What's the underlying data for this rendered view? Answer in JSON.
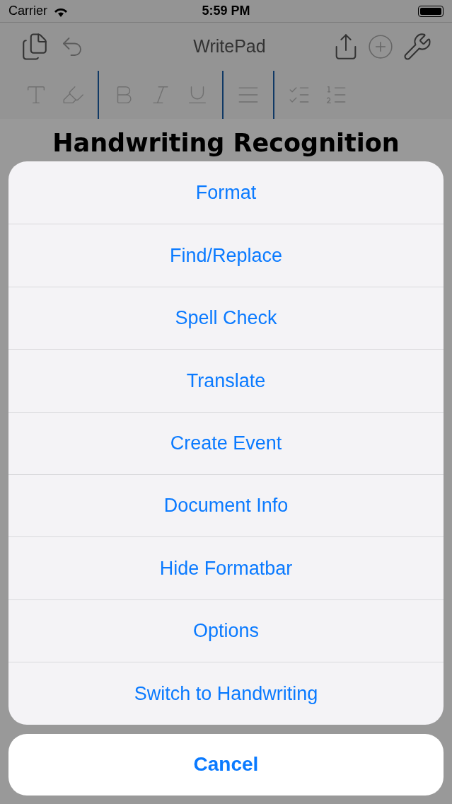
{
  "status_bar": {
    "carrier": "Carrier",
    "time": "5:59 PM"
  },
  "toolbar": {
    "title": "WritePad"
  },
  "document": {
    "heading": "Handwriting Recognition"
  },
  "action_sheet": {
    "items": [
      "Format",
      "Find/Replace",
      "Spell Check",
      "Translate",
      "Create Event",
      "Document Info",
      "Hide Formatbar",
      "Options",
      "Switch to Handwriting"
    ],
    "cancel": "Cancel"
  }
}
